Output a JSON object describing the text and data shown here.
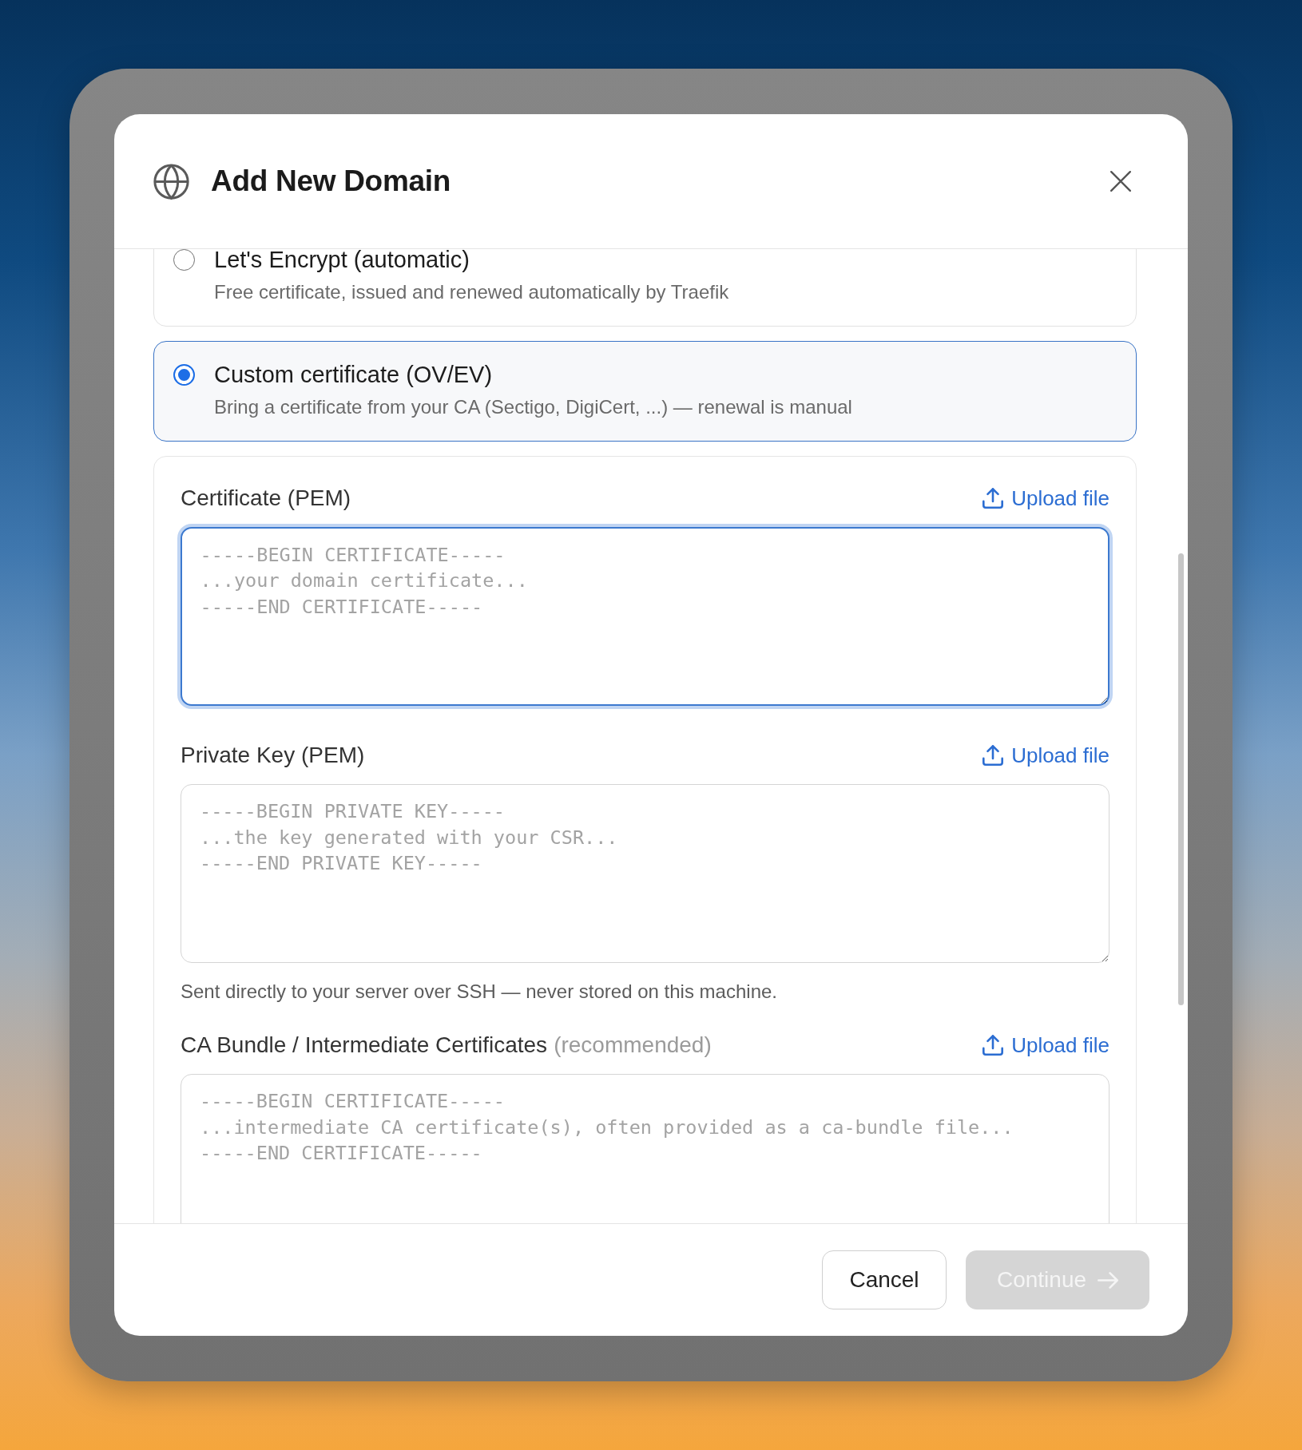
{
  "dialog": {
    "title": "Add New Domain"
  },
  "certificate_options": [
    {
      "title": "Let's Encrypt (automatic)",
      "description": "Free certificate, issued and renewed automatically by Traefik",
      "selected": false
    },
    {
      "title": "Custom certificate (OV/EV)",
      "description": "Bring a certificate from your CA (Sectigo, DigiCert, ...) — renewal is manual",
      "selected": true
    }
  ],
  "fields": [
    {
      "label": "Certificate (PEM)",
      "upload": "Upload file",
      "placeholder": "-----BEGIN CERTIFICATE-----\n...your domain certificate...\n-----END CERTIFICATE-----",
      "focused": true
    },
    {
      "label": "Private Key (PEM)",
      "upload": "Upload file",
      "placeholder": "-----BEGIN PRIVATE KEY-----\n...the key generated with your CSR...\n-----END PRIVATE KEY-----",
      "focused": false,
      "hint": "Sent directly to your server over SSH — never stored on this machine."
    },
    {
      "label": "CA Bundle / Intermediate Certificates",
      "note": "(recommended)",
      "upload": "Upload file",
      "placeholder": "-----BEGIN CERTIFICATE-----\n...intermediate CA certificate(s), often provided as a ca-bundle file...\n-----END CERTIFICATE-----",
      "focused": false
    }
  ],
  "footer": {
    "buttons": [
      {
        "label": "Cancel",
        "kind": "secondary",
        "disabled": false
      },
      {
        "label": "Continue",
        "kind": "primary",
        "disabled": true
      }
    ]
  }
}
